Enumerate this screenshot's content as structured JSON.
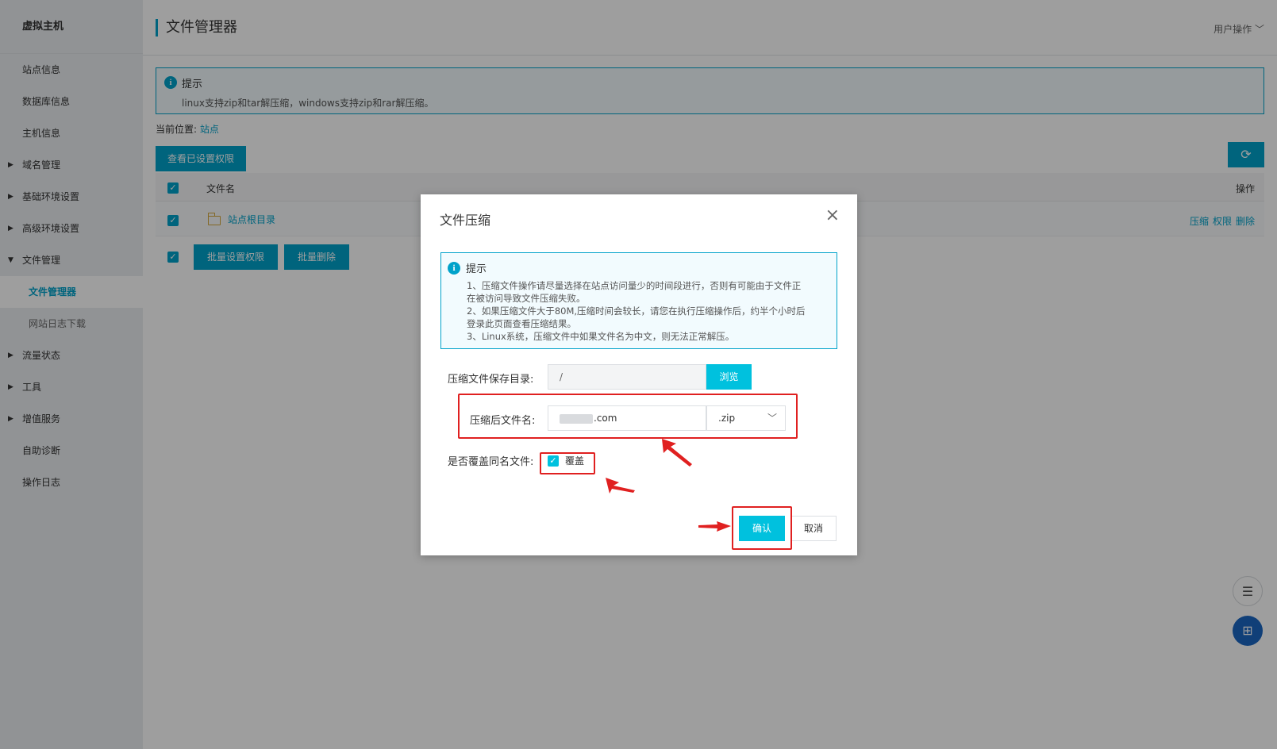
{
  "sidebar": {
    "brand": "虚拟主机",
    "items": [
      {
        "label": "站点信息",
        "arrow": "",
        "sub": false,
        "active": false
      },
      {
        "label": "数据库信息",
        "arrow": "",
        "sub": false,
        "active": false
      },
      {
        "label": "主机信息",
        "arrow": "",
        "sub": false,
        "active": false
      },
      {
        "label": "域名管理",
        "arrow": "▶",
        "sub": false,
        "active": false
      },
      {
        "label": "基础环境设置",
        "arrow": "▶",
        "sub": false,
        "active": false
      },
      {
        "label": "高级环境设置",
        "arrow": "▶",
        "sub": false,
        "active": false
      },
      {
        "label": "文件管理",
        "arrow": "▼",
        "sub": false,
        "active": false
      },
      {
        "label": "文件管理器",
        "arrow": "",
        "sub": true,
        "active": true
      },
      {
        "label": "网站日志下载",
        "arrow": "",
        "sub": true,
        "active": false
      },
      {
        "label": "流量状态",
        "arrow": "▶",
        "sub": false,
        "active": false
      },
      {
        "label": "工具",
        "arrow": "▶",
        "sub": false,
        "active": false
      },
      {
        "label": "增值服务",
        "arrow": "▶",
        "sub": false,
        "active": false
      },
      {
        "label": "自助诊断",
        "arrow": "",
        "sub": false,
        "active": false
      },
      {
        "label": "操作日志",
        "arrow": "",
        "sub": false,
        "active": false
      }
    ]
  },
  "header": {
    "title": "文件管理器",
    "user_ops": "用户操作 ﹀"
  },
  "tip": {
    "title": "提示",
    "text": "linux支持zip和tar解压缩，windows支持zip和rar解压缩。"
  },
  "location": {
    "label": "当前位置:",
    "link": "站点"
  },
  "toolbar": {
    "view_perms": "查看已设置权限",
    "refresh_icon": "refresh-icon"
  },
  "table": {
    "col_name": "文件名",
    "col_ops": "操作",
    "rows": [
      {
        "name": "站点根目录",
        "ops": [
          "压缩",
          "权限",
          "删除"
        ]
      }
    ]
  },
  "batch": {
    "set_perms": "批量设置权限",
    "delete": "批量删除"
  },
  "modal": {
    "title": "文件压缩",
    "close": "×",
    "tip_title": "提示",
    "tip_lines": [
      "1、压缩文件操作请尽量选择在站点访问量少的时间段进行，否则有可能由于文件正",
      "在被访问导致文件压缩失败。",
      "2、如果压缩文件大于80M,压缩时间会较长，请您在执行压缩操作后，约半个小时后",
      "登录此页面查看压缩结果。",
      "3、Linux系统，压缩文件中如果文件名为中文，则无法正常解压。"
    ],
    "save_dir_label": "压缩文件保存目录:",
    "save_dir_value": "/",
    "browse": "浏览",
    "filename_label": "压缩后文件名:",
    "filename_value": ".com",
    "ext_value": ".zip",
    "overwrite_label": "是否覆盖同名文件:",
    "overwrite_option": "覆盖",
    "overwrite_checked": true,
    "confirm": "确认",
    "cancel": "取消"
  },
  "colors": {
    "accent": "#00a2ca",
    "button": "#00c1de",
    "annotation": "#e02020"
  }
}
